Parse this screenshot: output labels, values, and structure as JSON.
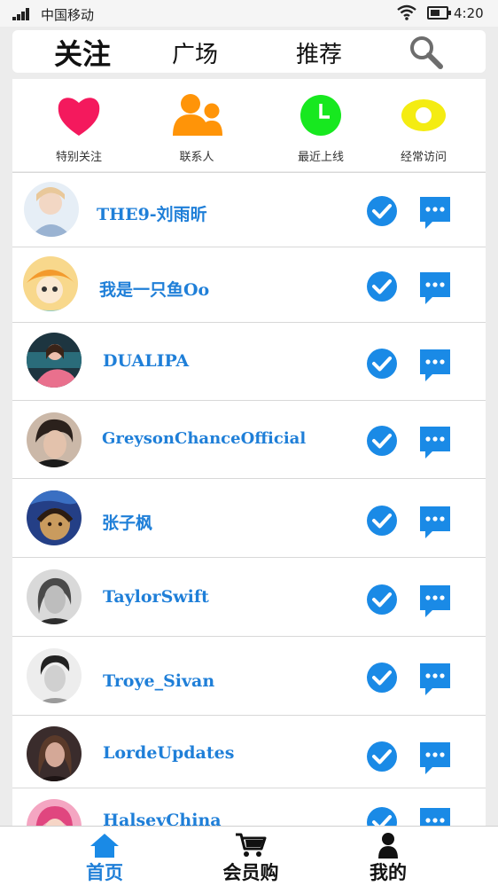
{
  "status_bar": {
    "carrier": "中国移动",
    "time": "4:20"
  },
  "tabs": [
    {
      "label": "关注",
      "active": true
    },
    {
      "label": "广场",
      "active": false
    },
    {
      "label": "推荐",
      "active": false
    }
  ],
  "search": {
    "icon": "search-icon"
  },
  "quick_categories": [
    {
      "label": "特别关注",
      "icon": "heart-icon",
      "color": "#f4195d"
    },
    {
      "label": "联系人",
      "icon": "contacts-icon",
      "color": "#ff9408"
    },
    {
      "label": "最近上线",
      "icon": "clock-icon",
      "color": "#17e81f"
    },
    {
      "label": "经常访问",
      "icon": "eye-icon",
      "color": "#f4ec12"
    }
  ],
  "following": [
    {
      "name": "THE9-刘雨昕",
      "verified": true
    },
    {
      "name": "我是一只鱼Oo",
      "verified": true
    },
    {
      "name": "DUALIPA",
      "verified": true
    },
    {
      "name": "GreysonChanceOfficial",
      "verified": true
    },
    {
      "name": "张子枫",
      "verified": true
    },
    {
      "name": "TaylorSwift",
      "verified": true
    },
    {
      "name": "Troye_Sivan",
      "verified": true
    },
    {
      "name": "LordeUpdates",
      "verified": true
    },
    {
      "name": "HalseyChina",
      "verified": true
    }
  ],
  "bottom_nav": [
    {
      "label": "首页",
      "icon": "home-icon",
      "active": true
    },
    {
      "label": "会员购",
      "icon": "cart-icon",
      "active": false
    },
    {
      "label": "我的",
      "icon": "user-icon",
      "active": false
    }
  ],
  "colors": {
    "accent": "#1f7fd8",
    "check": "#1a8ae6"
  }
}
